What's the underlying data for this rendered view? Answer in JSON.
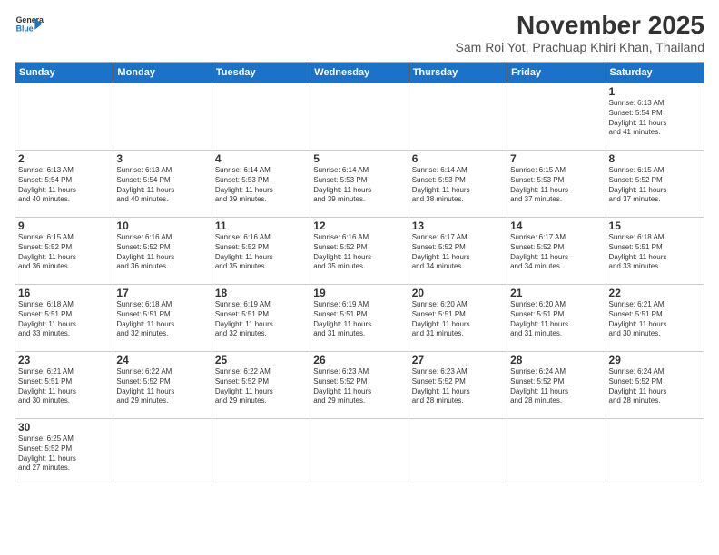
{
  "header": {
    "logo_general": "General",
    "logo_blue": "Blue",
    "month": "November 2025",
    "location": "Sam Roi Yot, Prachuap Khiri Khan, Thailand"
  },
  "days_of_week": [
    "Sunday",
    "Monday",
    "Tuesday",
    "Wednesday",
    "Thursday",
    "Friday",
    "Saturday"
  ],
  "weeks": [
    [
      {
        "day": "",
        "info": ""
      },
      {
        "day": "",
        "info": ""
      },
      {
        "day": "",
        "info": ""
      },
      {
        "day": "",
        "info": ""
      },
      {
        "day": "",
        "info": ""
      },
      {
        "day": "",
        "info": ""
      },
      {
        "day": "1",
        "info": "Sunrise: 6:13 AM\nSunset: 5:54 PM\nDaylight: 11 hours\nand 41 minutes."
      }
    ],
    [
      {
        "day": "2",
        "info": "Sunrise: 6:13 AM\nSunset: 5:54 PM\nDaylight: 11 hours\nand 40 minutes."
      },
      {
        "day": "3",
        "info": "Sunrise: 6:13 AM\nSunset: 5:54 PM\nDaylight: 11 hours\nand 40 minutes."
      },
      {
        "day": "4",
        "info": "Sunrise: 6:14 AM\nSunset: 5:53 PM\nDaylight: 11 hours\nand 39 minutes."
      },
      {
        "day": "5",
        "info": "Sunrise: 6:14 AM\nSunset: 5:53 PM\nDaylight: 11 hours\nand 39 minutes."
      },
      {
        "day": "6",
        "info": "Sunrise: 6:14 AM\nSunset: 5:53 PM\nDaylight: 11 hours\nand 38 minutes."
      },
      {
        "day": "7",
        "info": "Sunrise: 6:15 AM\nSunset: 5:53 PM\nDaylight: 11 hours\nand 37 minutes."
      },
      {
        "day": "8",
        "info": "Sunrise: 6:15 AM\nSunset: 5:52 PM\nDaylight: 11 hours\nand 37 minutes."
      }
    ],
    [
      {
        "day": "9",
        "info": "Sunrise: 6:15 AM\nSunset: 5:52 PM\nDaylight: 11 hours\nand 36 minutes."
      },
      {
        "day": "10",
        "info": "Sunrise: 6:16 AM\nSunset: 5:52 PM\nDaylight: 11 hours\nand 36 minutes."
      },
      {
        "day": "11",
        "info": "Sunrise: 6:16 AM\nSunset: 5:52 PM\nDaylight: 11 hours\nand 35 minutes."
      },
      {
        "day": "12",
        "info": "Sunrise: 6:16 AM\nSunset: 5:52 PM\nDaylight: 11 hours\nand 35 minutes."
      },
      {
        "day": "13",
        "info": "Sunrise: 6:17 AM\nSunset: 5:52 PM\nDaylight: 11 hours\nand 34 minutes."
      },
      {
        "day": "14",
        "info": "Sunrise: 6:17 AM\nSunset: 5:52 PM\nDaylight: 11 hours\nand 34 minutes."
      },
      {
        "day": "15",
        "info": "Sunrise: 6:18 AM\nSunset: 5:51 PM\nDaylight: 11 hours\nand 33 minutes."
      }
    ],
    [
      {
        "day": "16",
        "info": "Sunrise: 6:18 AM\nSunset: 5:51 PM\nDaylight: 11 hours\nand 33 minutes."
      },
      {
        "day": "17",
        "info": "Sunrise: 6:18 AM\nSunset: 5:51 PM\nDaylight: 11 hours\nand 32 minutes."
      },
      {
        "day": "18",
        "info": "Sunrise: 6:19 AM\nSunset: 5:51 PM\nDaylight: 11 hours\nand 32 minutes."
      },
      {
        "day": "19",
        "info": "Sunrise: 6:19 AM\nSunset: 5:51 PM\nDaylight: 11 hours\nand 31 minutes."
      },
      {
        "day": "20",
        "info": "Sunrise: 6:20 AM\nSunset: 5:51 PM\nDaylight: 11 hours\nand 31 minutes."
      },
      {
        "day": "21",
        "info": "Sunrise: 6:20 AM\nSunset: 5:51 PM\nDaylight: 11 hours\nand 31 minutes."
      },
      {
        "day": "22",
        "info": "Sunrise: 6:21 AM\nSunset: 5:51 PM\nDaylight: 11 hours\nand 30 minutes."
      }
    ],
    [
      {
        "day": "23",
        "info": "Sunrise: 6:21 AM\nSunset: 5:51 PM\nDaylight: 11 hours\nand 30 minutes."
      },
      {
        "day": "24",
        "info": "Sunrise: 6:22 AM\nSunset: 5:52 PM\nDaylight: 11 hours\nand 29 minutes."
      },
      {
        "day": "25",
        "info": "Sunrise: 6:22 AM\nSunset: 5:52 PM\nDaylight: 11 hours\nand 29 minutes."
      },
      {
        "day": "26",
        "info": "Sunrise: 6:23 AM\nSunset: 5:52 PM\nDaylight: 11 hours\nand 29 minutes."
      },
      {
        "day": "27",
        "info": "Sunrise: 6:23 AM\nSunset: 5:52 PM\nDaylight: 11 hours\nand 28 minutes."
      },
      {
        "day": "28",
        "info": "Sunrise: 6:24 AM\nSunset: 5:52 PM\nDaylight: 11 hours\nand 28 minutes."
      },
      {
        "day": "29",
        "info": "Sunrise: 6:24 AM\nSunset: 5:52 PM\nDaylight: 11 hours\nand 28 minutes."
      }
    ],
    [
      {
        "day": "30",
        "info": "Sunrise: 6:25 AM\nSunset: 5:52 PM\nDaylight: 11 hours\nand 27 minutes."
      },
      {
        "day": "",
        "info": ""
      },
      {
        "day": "",
        "info": ""
      },
      {
        "day": "",
        "info": ""
      },
      {
        "day": "",
        "info": ""
      },
      {
        "day": "",
        "info": ""
      },
      {
        "day": "",
        "info": ""
      }
    ]
  ]
}
